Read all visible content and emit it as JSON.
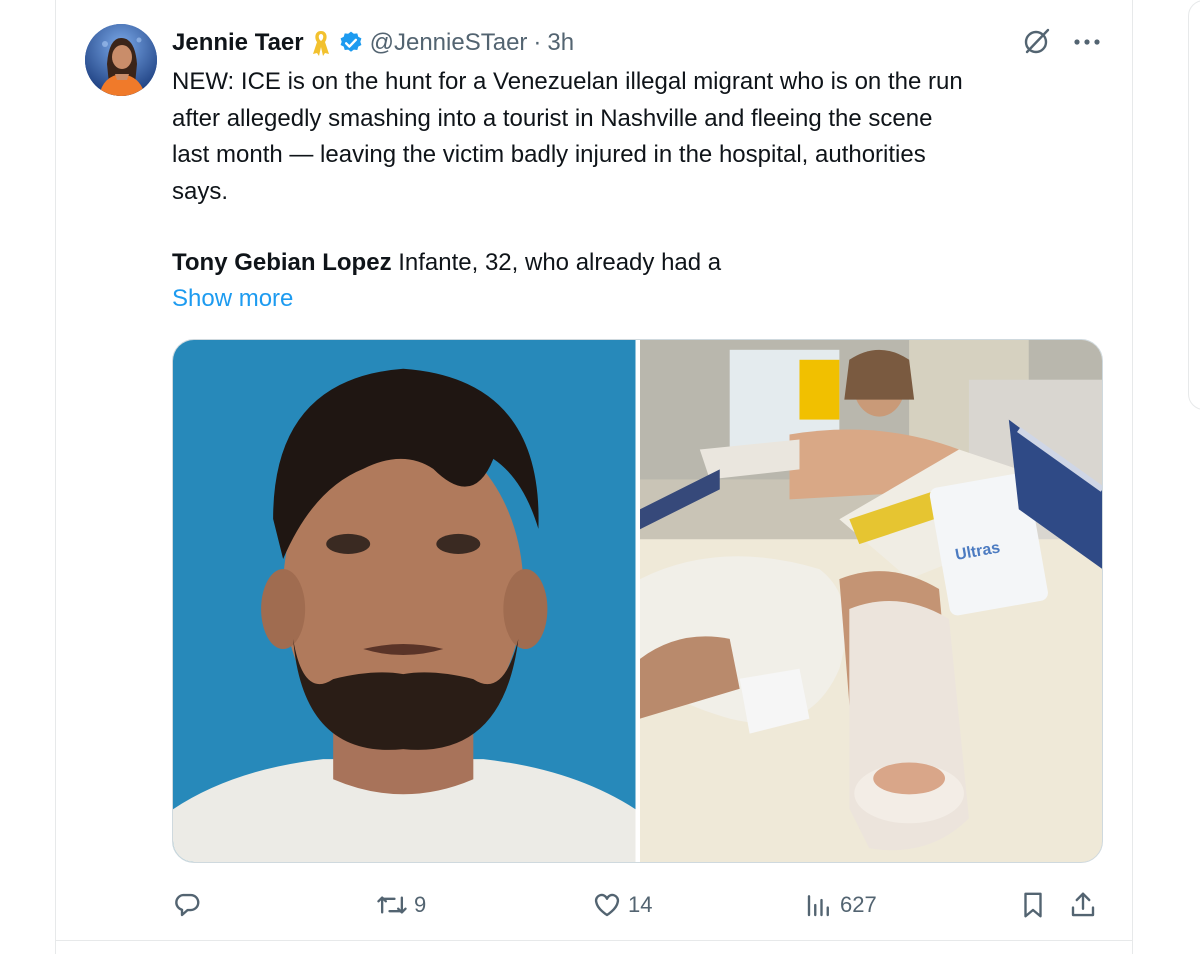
{
  "author": {
    "display_name": "Jennie Taer",
    "handle": "@JennieSTaer",
    "separator": "·",
    "time": "3h"
  },
  "tweet": {
    "text": "NEW: ICE is on the hunt for a Venezuelan illegal migrant who is on the run\nafter allegedly smashing into a tourist in Nashville and fleeing the scene\nlast month — leaving the victim badly injured in the hospital, authorities\nsays.",
    "para2_bold": "Tony Gebian Lopez",
    "para2_rest": " Infante, 32, who already had a",
    "show_more": "Show more"
  },
  "media": {
    "photo_left_icon": "mugshot-photo",
    "photo_right_icon": "hospital-bed-photo",
    "photo_right_packet_text": "Ultras"
  },
  "actions": {
    "reply_count": "",
    "retweet_count": "9",
    "like_count": "14",
    "views_count": "627"
  },
  "colors": {
    "accent": "#1d9bf0",
    "muted": "#536471",
    "ribbon": "#f2c12e",
    "verified": "#1d9bf0"
  }
}
